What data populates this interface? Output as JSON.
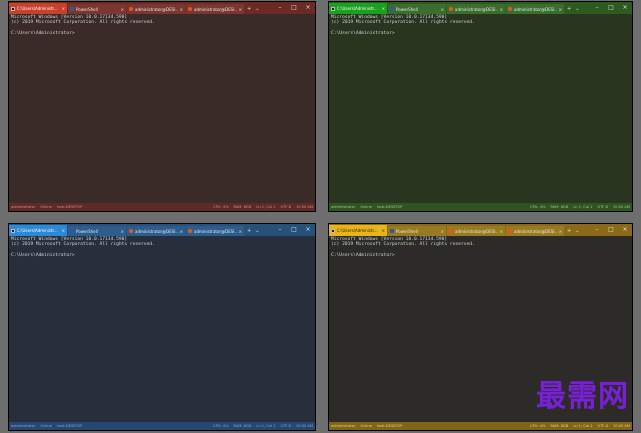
{
  "windows": [
    {
      "theme": "red",
      "tabs": [
        {
          "label": "C:\\Users\\Administr...",
          "icon": "cmd-icon",
          "active": true
        },
        {
          "label": "PowerShell",
          "icon": "powershell-icon",
          "active": false
        },
        {
          "label": "administrator@DESI...",
          "icon": "ubuntu-icon",
          "active": false
        },
        {
          "label": "administrator@DESI...",
          "icon": "ubuntu-icon",
          "active": false
        }
      ],
      "terminal": {
        "line1": "Microsoft Windows [Version 10.0.17134.590]",
        "line2": "(c) 2019 Microsoft Corporation. All rights reserved.",
        "prompt": "C:\\Users\\Administrator>"
      },
      "status": {
        "left": [
          "administrator",
          "Online",
          "host:DESKTOP"
        ],
        "right": [
          "CPU: 4%",
          "RAM: 8GB",
          "Ln 1, Col 1",
          "UTF-8",
          "10:00 AM"
        ]
      }
    },
    {
      "theme": "green",
      "tabs": [
        {
          "label": "C:\\Users\\Administr...",
          "icon": "cmd-icon",
          "active": true
        },
        {
          "label": "PowerShell",
          "icon": "powershell-icon",
          "active": false
        },
        {
          "label": "administrator@DESI...",
          "icon": "ubuntu-icon",
          "active": false
        },
        {
          "label": "administrator@DESI...",
          "icon": "ubuntu-icon",
          "active": false
        }
      ],
      "terminal": {
        "line1": "Microsoft Windows [Version 10.0.17134.590]",
        "line2": "(c) 2019 Microsoft Corporation. All rights reserved.",
        "prompt": "C:\\Users\\Administrator>"
      },
      "status": {
        "left": [
          "administrator",
          "Online",
          "host:DESKTOP"
        ],
        "right": [
          "CPU: 4%",
          "RAM: 8GB",
          "Ln 1, Col 1",
          "UTF-8",
          "10:00 AM"
        ]
      }
    },
    {
      "theme": "blue",
      "tabs": [
        {
          "label": "C:\\Users\\Administr...",
          "icon": "cmd-icon",
          "active": true
        },
        {
          "label": "PowerShell",
          "icon": "powershell-icon",
          "active": false
        },
        {
          "label": "administrator@DESI...",
          "icon": "ubuntu-icon",
          "active": false
        },
        {
          "label": "administrator@DESI...",
          "icon": "ubuntu-icon",
          "active": false
        }
      ],
      "terminal": {
        "line1": "Microsoft Windows [Version 10.0.17134.590]",
        "line2": "(c) 2019 Microsoft Corporation. All rights reserved.",
        "prompt": "C:\\Users\\Administrator>"
      },
      "status": {
        "left": [
          "administrator",
          "Online",
          "host:DESKTOP"
        ],
        "right": [
          "CPU: 4%",
          "RAM: 8GB",
          "Ln 1, Col 1",
          "UTF-8",
          "10:00 AM"
        ]
      }
    },
    {
      "theme": "yellow",
      "tabs": [
        {
          "label": "C:\\Users\\Administr...",
          "icon": "cmd-icon",
          "active": true
        },
        {
          "label": "PowerShell",
          "icon": "powershell-icon",
          "active": false
        },
        {
          "label": "administrator@DESI...",
          "icon": "ubuntu-icon",
          "active": false
        },
        {
          "label": "administrator@DESI...",
          "icon": "ubuntu-icon",
          "active": false
        }
      ],
      "terminal": {
        "line1": "Microsoft Windows [Version 10.0.17134.590]",
        "line2": "(c) 2019 Microsoft Corporation. All rights reserved.",
        "prompt": "C:\\Users\\Administrator>"
      },
      "status": {
        "left": [
          "administrator",
          "Online",
          "host:DESKTOP"
        ],
        "right": [
          "CPU: 4%",
          "RAM: 8GB",
          "Ln 1, Col 1",
          "UTF-8",
          "10:00 AM"
        ]
      }
    }
  ],
  "tab_controls": {
    "close": "×",
    "new_tab": "+",
    "dropdown": "⌄"
  },
  "caption_buttons": {
    "minimize": "–",
    "maximize": "□",
    "close": "×"
  },
  "watermark": "最需网",
  "colors": {
    "desktop": "#6e6e6e",
    "red_accent": "#c8402a",
    "green_accent": "#19a01c",
    "blue_accent": "#2a8ad8",
    "yellow_accent": "#e8b418",
    "watermark": "#7a1fd8"
  }
}
